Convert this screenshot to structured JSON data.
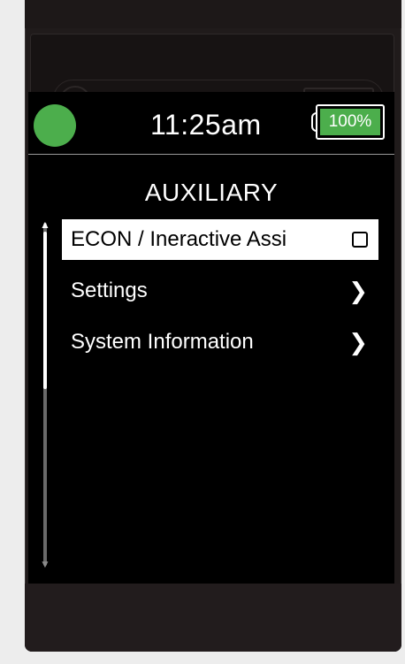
{
  "status": {
    "time": "11:25am",
    "battery_label": "100%",
    "battery_level": 1.0,
    "indicator_color": "#4cae4c"
  },
  "screen": {
    "title": "AUXILIARY"
  },
  "menu": {
    "items": [
      {
        "label": "ECON / Ineractive Assi",
        "control": "checkbox",
        "checked": false,
        "selected": true
      },
      {
        "label": "Settings",
        "control": "chevron-right-icon",
        "selected": false
      },
      {
        "label": "System Information",
        "control": "chevron-right-icon",
        "selected": false
      }
    ]
  },
  "icons": {
    "scroll_up": "arrow-up-icon",
    "scroll_down": "arrow-down-icon",
    "chevron": "chevron-right-icon",
    "chevron_glyph": "❯"
  },
  "colors": {
    "accent_green": "#4cae4c",
    "screen_bg": "#000000",
    "selection_bg": "#ffffff"
  }
}
